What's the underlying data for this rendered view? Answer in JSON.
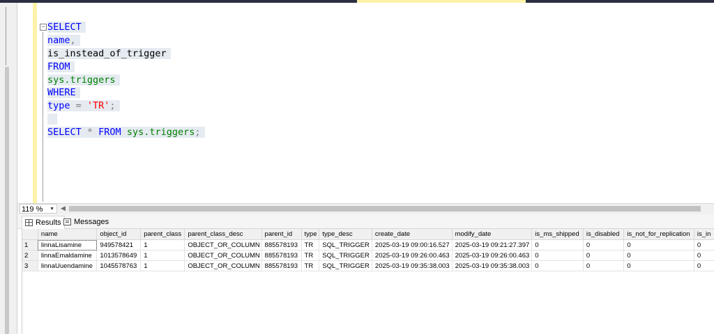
{
  "editor": {
    "lines": [
      [
        {
          "t": "SELECT",
          "c": "kw"
        }
      ],
      [
        {
          "t": "name",
          "c": "kw"
        },
        {
          "t": ",",
          "c": "op"
        }
      ],
      [
        {
          "t": "is_instead_of_trigger",
          "c": "ident"
        }
      ],
      [
        {
          "t": "FROM",
          "c": "kw"
        }
      ],
      [
        {
          "t": "sys.triggers",
          "c": "sys"
        }
      ],
      [
        {
          "t": "WHERE",
          "c": "kw"
        }
      ],
      [
        {
          "t": "type",
          "c": "kw"
        },
        {
          "t": " = ",
          "c": "op"
        },
        {
          "t": "'TR'",
          "c": "str"
        },
        {
          "t": ";",
          "c": "op"
        }
      ],
      [
        {
          "t": " ",
          "c": "ident"
        }
      ],
      [
        {
          "t": "SELECT",
          "c": "kw"
        },
        {
          "t": " * ",
          "c": "op"
        },
        {
          "t": "FROM",
          "c": "kw"
        },
        {
          "t": " ",
          "c": "ident"
        },
        {
          "t": "sys.triggers",
          "c": "sys"
        },
        {
          "t": ";",
          "c": "op"
        }
      ]
    ]
  },
  "zoom": {
    "value": "119 %"
  },
  "results_tabs": {
    "results": "Results",
    "messages": "Messages"
  },
  "grid": {
    "columns": [
      "name",
      "object_id",
      "parent_class",
      "parent_class_desc",
      "parent_id",
      "type",
      "type_desc",
      "create_date",
      "modify_date",
      "is_ms_shipped",
      "is_disabled",
      "is_not_for_replication",
      "is_in"
    ],
    "column_widths": [
      86,
      64,
      64,
      110,
      58,
      26,
      76,
      115,
      115,
      75,
      60,
      102,
      30
    ],
    "rows": [
      [
        "1",
        "linnaLisamine",
        "949578421",
        "1",
        "OBJECT_OR_COLUMN",
        "885578193",
        "TR",
        "SQL_TRIGGER",
        "2025-03-19 09:00:16.527",
        "2025-03-19 09:21:27.397",
        "0",
        "0",
        "0",
        "0"
      ],
      [
        "2",
        "linnaEmaldamine",
        "1013578649",
        "1",
        "OBJECT_OR_COLUMN",
        "885578193",
        "TR",
        "SQL_TRIGGER",
        "2025-03-19 09:26:00.463",
        "2025-03-19 09:26:00.463",
        "0",
        "0",
        "0",
        "0"
      ],
      [
        "3",
        "linnaUuendamine",
        "1045578763",
        "1",
        "OBJECT_OR_COLUMN",
        "885578193",
        "TR",
        "SQL_TRIGGER",
        "2025-03-19 09:35:38.003",
        "2025-03-19 09:35:38.003",
        "0",
        "0",
        "0",
        "0"
      ]
    ]
  },
  "colors": {
    "keyword": "#0000ff",
    "system": "#008000",
    "string": "#ff0000",
    "operator": "#808080",
    "selection": "#e5ebf1",
    "margin": "#fdf2a8"
  }
}
